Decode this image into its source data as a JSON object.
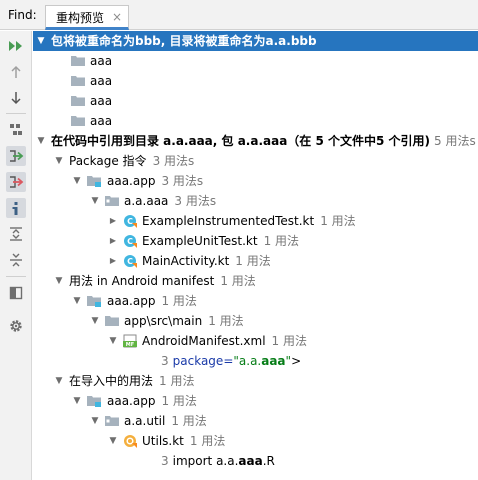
{
  "find": {
    "label": "Find:",
    "tab_label": "重构预览",
    "close_glyph": "×"
  },
  "toolbar": {
    "buttons": [
      {
        "name": "run-refactoring-icon",
        "pressed": false
      },
      {
        "name": "previous-occurrence-icon",
        "pressed": false
      },
      {
        "name": "next-occurrence-icon",
        "pressed": false
      },
      {
        "name": "group-by-icon",
        "pressed": false
      },
      {
        "name": "show-read-access-icon",
        "pressed": true
      },
      {
        "name": "show-write-access-icon",
        "pressed": true
      },
      {
        "name": "show-imports-icon",
        "pressed": true
      },
      {
        "name": "expand-all-icon",
        "pressed": false
      },
      {
        "name": "collapse-all-icon",
        "pressed": false
      },
      {
        "name": "preview-panel-icon",
        "pressed": false
      },
      {
        "name": "settings-icon",
        "pressed": false
      }
    ]
  },
  "tree": {
    "root_header": "包将被重命名为bbb, 目录将被重命名为a.a.bbb",
    "dirs": [
      "aaa",
      "aaa",
      "aaa",
      "aaa"
    ],
    "refs_header": {
      "main": "在代码中引用到目录 a.a.aaa, 包 a.a.aaa（在 5 个文件中5 个引用)",
      "count": "5 用法s"
    },
    "package_group": {
      "label": "Package 指令",
      "count": "3 用法s",
      "module": {
        "label": "aaa.app",
        "count": "3 用法s"
      },
      "package": {
        "label": "a.a.aaa",
        "count": "3 用法s"
      },
      "files": [
        {
          "label": "ExampleInstrumentedTest.kt",
          "count": "1 用法"
        },
        {
          "label": "ExampleUnitTest.kt",
          "count": "1 用法"
        },
        {
          "label": "MainActivity.kt",
          "count": "1 用法"
        }
      ]
    },
    "manifest_group": {
      "label": "用法 in Android manifest",
      "count": "1 用法",
      "module": {
        "label": "aaa.app",
        "count": "1 用法"
      },
      "dir": {
        "label": "app\\src\\main",
        "count": "1 用法"
      },
      "file": {
        "label": "AndroidManifest.xml",
        "count": "1 用法"
      },
      "code": {
        "line": "3",
        "attr": "package",
        "eq": "=",
        "q1": "\"a.a.",
        "hl": "aaa",
        "q2": "\"",
        "tail": ">"
      }
    },
    "import_group": {
      "label": "在导入中的用法",
      "count": "1 用法",
      "module": {
        "label": "aaa.app",
        "count": "1 用法"
      },
      "package": {
        "label": "a.a.util",
        "count": "1 用法"
      },
      "file": {
        "label": "Utils.kt",
        "count": "1 用法"
      },
      "code": {
        "line": "3",
        "pre": "import a.a.",
        "hl": "aaa",
        "post": ".R"
      }
    }
  }
}
